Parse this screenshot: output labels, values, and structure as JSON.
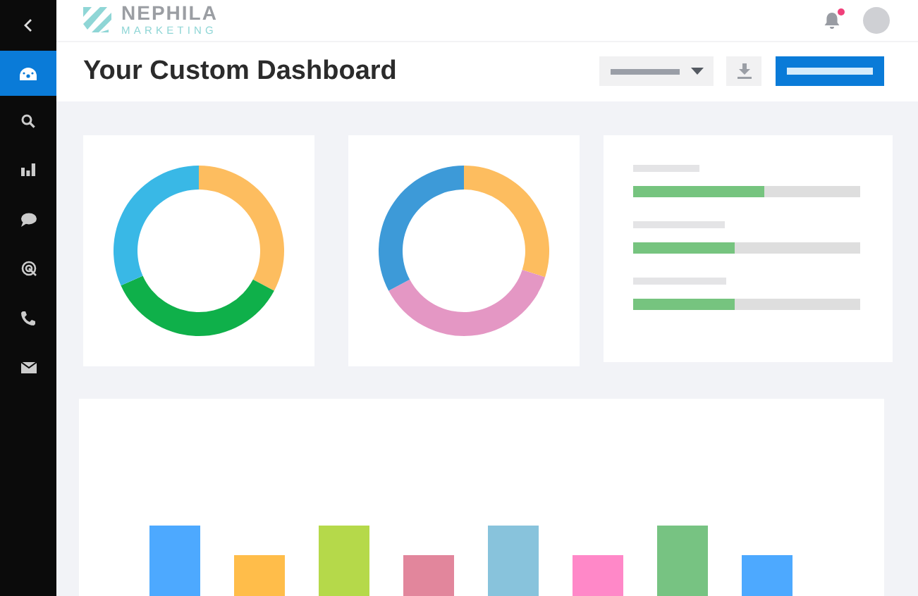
{
  "sidebar": {
    "items": [
      {
        "kind": "back",
        "selected": false
      },
      {
        "kind": "dashboard",
        "selected": true
      },
      {
        "kind": "search",
        "selected": false
      },
      {
        "kind": "chart",
        "selected": false
      },
      {
        "kind": "chat",
        "selected": false
      },
      {
        "kind": "target",
        "selected": false
      },
      {
        "kind": "phone",
        "selected": false
      },
      {
        "kind": "mail",
        "selected": false
      }
    ]
  },
  "header": {
    "logo": {
      "name": "NEPHILA",
      "tagline": "MARKETING"
    },
    "notifications": {
      "unread": true
    }
  },
  "title": "Your Custom Dashboard",
  "progress_card": {
    "rows": [
      {
        "level": 0.58
      },
      {
        "level": 0.45
      },
      {
        "level": 0.45
      }
    ]
  }
}
